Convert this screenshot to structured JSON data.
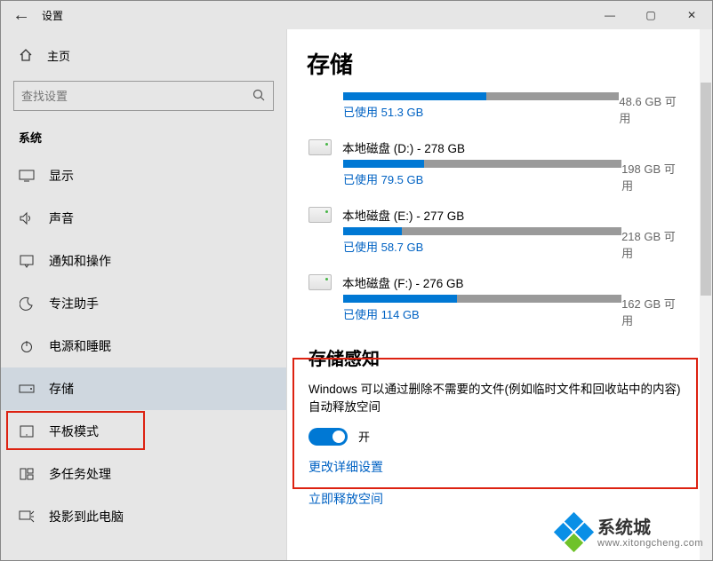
{
  "window": {
    "title": "设置"
  },
  "sidebar": {
    "home": "主页",
    "search_placeholder": "查找设置",
    "group": "系统",
    "items": [
      {
        "label": "显示"
      },
      {
        "label": "声音"
      },
      {
        "label": "通知和操作"
      },
      {
        "label": "专注助手"
      },
      {
        "label": "电源和睡眠"
      },
      {
        "label": "存储"
      },
      {
        "label": "平板模式"
      },
      {
        "label": "多任务处理"
      },
      {
        "label": "投影到此电脑"
      }
    ]
  },
  "page": {
    "title": "存储"
  },
  "drives": [
    {
      "title": "",
      "used_label": "已使用 51.3 GB",
      "free_label": "48.6 GB 可用",
      "fill_pct": 52,
      "partial": true
    },
    {
      "title": "本地磁盘 (D:) - 278 GB",
      "used_label": "已使用 79.5 GB",
      "free_label": "198 GB 可用",
      "fill_pct": 29
    },
    {
      "title": "本地磁盘 (E:) - 277 GB",
      "used_label": "已使用 58.7 GB",
      "free_label": "218 GB 可用",
      "fill_pct": 21
    },
    {
      "title": "本地磁盘 (F:) - 276 GB",
      "used_label": "已使用 114 GB",
      "free_label": "162 GB 可用",
      "fill_pct": 41
    }
  ],
  "storage_sense": {
    "heading": "存储感知",
    "description": "Windows 可以通过删除不需要的文件(例如临时文件和回收站中的内容)自动释放空间",
    "state_label": "开",
    "link_settings": "更改详细设置",
    "link_free_now": "立即释放空间"
  },
  "watermark": {
    "name": "系统城",
    "url": "www.xitongcheng.com"
  },
  "chart_data": [
    {
      "type": "bar",
      "title": "",
      "categories": [
        "已使用",
        "可用"
      ],
      "values": [
        51.3,
        48.6
      ],
      "xlabel": "",
      "ylabel": "GB",
      "ylim": [
        0,
        100
      ]
    },
    {
      "type": "bar",
      "title": "本地磁盘 (D:) - 278 GB",
      "categories": [
        "已使用",
        "可用"
      ],
      "values": [
        79.5,
        198
      ],
      "xlabel": "",
      "ylabel": "GB",
      "ylim": [
        0,
        278
      ]
    },
    {
      "type": "bar",
      "title": "本地磁盘 (E:) - 277 GB",
      "categories": [
        "已使用",
        "可用"
      ],
      "values": [
        58.7,
        218
      ],
      "xlabel": "",
      "ylabel": "GB",
      "ylim": [
        0,
        277
      ]
    },
    {
      "type": "bar",
      "title": "本地磁盘 (F:) - 276 GB",
      "categories": [
        "已使用",
        "可用"
      ],
      "values": [
        114,
        162
      ],
      "xlabel": "",
      "ylabel": "GB",
      "ylim": [
        0,
        276
      ]
    }
  ]
}
